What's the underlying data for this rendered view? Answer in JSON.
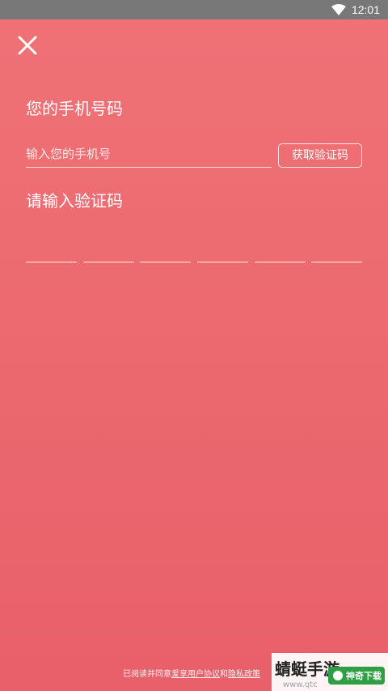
{
  "status_bar": {
    "time": "12:01",
    "icons": [
      "wifi-icon"
    ]
  },
  "header": {
    "close_icon": "close-icon"
  },
  "phone": {
    "label": "您的手机号码",
    "placeholder": "输入您的手机号",
    "value": "",
    "get_code_label": "获取验证码"
  },
  "verification": {
    "label": "请输入验证码",
    "digits": [
      "",
      "",
      "",
      "",
      "",
      ""
    ]
  },
  "footer": {
    "prefix": "已阅读并同意",
    "agreement_link": "爱享用户协议",
    "connector": "和",
    "privacy_link": "隐私政策"
  },
  "watermark": {
    "title": "蜻蜓手游",
    "url": "www.qtc",
    "badge": "神奇下载"
  },
  "colors": {
    "background_top": "#ef7277",
    "background_bottom": "#e8606a",
    "status_bar": "#787878",
    "text": "#ffffff"
  }
}
